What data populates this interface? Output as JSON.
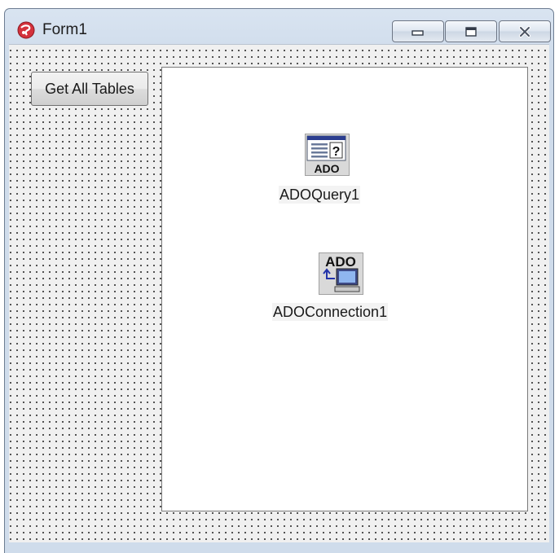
{
  "window": {
    "title": "Form1",
    "controls": [
      "minimize-icon",
      "maximize-icon",
      "close-icon"
    ]
  },
  "form": {
    "button_label": "Get All Tables"
  },
  "components": {
    "query": {
      "label": "ADOQuery1",
      "icon_text": "ADO",
      "icon": "ado-query-icon"
    },
    "connection": {
      "label": "ADOConnection1",
      "icon_text": "ADO",
      "icon": "ado-connection-icon"
    }
  },
  "colors": {
    "title_bar": "#cfdceb",
    "client_bg": "#f0f0f0",
    "grid_dot": "#2a2a2a",
    "panel_bg": "#ffffff"
  }
}
